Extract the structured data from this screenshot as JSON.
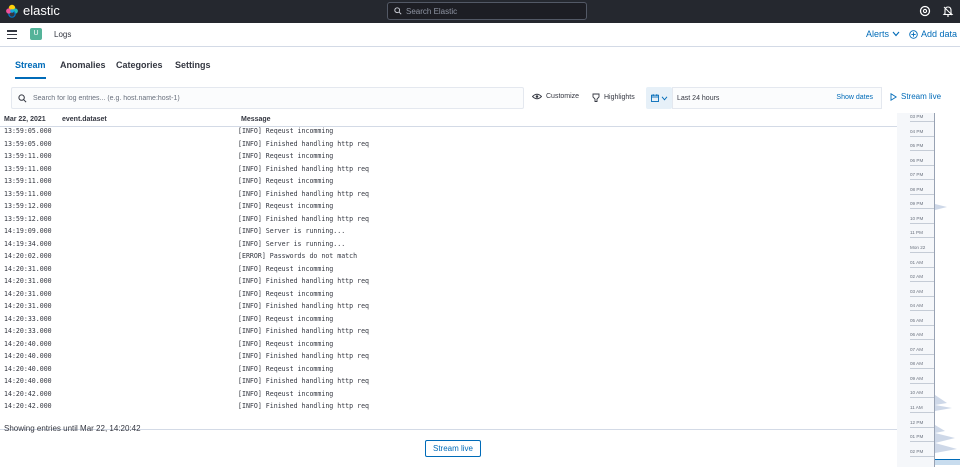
{
  "topbar": {
    "brand": "elastic",
    "search_placeholder": "Search Elastic"
  },
  "subbar": {
    "space_initial": "U",
    "breadcrumb": "Logs",
    "alerts_label": "Alerts",
    "add_data_label": "Add data"
  },
  "tabs": [
    {
      "label": "Stream",
      "active": true
    },
    {
      "label": "Anomalies",
      "active": false
    },
    {
      "label": "Categories",
      "active": false
    },
    {
      "label": "Settings",
      "active": false
    }
  ],
  "toolbar": {
    "search_placeholder": "Search for log entries... (e.g. host.name:host-1)",
    "customize_label": "Customize",
    "highlights_label": "Highlights",
    "time_range": "Last 24 hours",
    "show_dates_label": "Show dates",
    "stream_live_label": "Stream live"
  },
  "table": {
    "date_header": "Mar 22, 2021",
    "dataset_header": "event.dataset",
    "message_header": "Message",
    "rows": [
      {
        "ts": "13:59:05.000",
        "msg": "[INFO] Reqeust incomming"
      },
      {
        "ts": "13:59:05.000",
        "msg": "[INFO] Finished handling http req"
      },
      {
        "ts": "13:59:11.000",
        "msg": "[INFO] Reqeust incomming"
      },
      {
        "ts": "13:59:11.000",
        "msg": "[INFO] Finished handling http req"
      },
      {
        "ts": "13:59:11.000",
        "msg": "[INFO] Reqeust incomming"
      },
      {
        "ts": "13:59:11.000",
        "msg": "[INFO] Finished handling http req"
      },
      {
        "ts": "13:59:12.000",
        "msg": "[INFO] Reqeust incomming"
      },
      {
        "ts": "13:59:12.000",
        "msg": "[INFO] Finished handling http req"
      },
      {
        "ts": "14:19:09.000",
        "msg": "[INFO] Server is running..."
      },
      {
        "ts": "14:19:34.000",
        "msg": "[INFO] Server is running..."
      },
      {
        "ts": "14:20:02.000",
        "msg": "[ERROR] Passwords do not match"
      },
      {
        "ts": "14:20:31.000",
        "msg": "[INFO] Reqeust incomming"
      },
      {
        "ts": "14:20:31.000",
        "msg": "[INFO] Finished handling http req"
      },
      {
        "ts": "14:20:31.000",
        "msg": "[INFO] Reqeust incomming"
      },
      {
        "ts": "14:20:31.000",
        "msg": "[INFO] Finished handling http req"
      },
      {
        "ts": "14:20:33.000",
        "msg": "[INFO] Reqeust incomming"
      },
      {
        "ts": "14:20:33.000",
        "msg": "[INFO] Finished handling http req"
      },
      {
        "ts": "14:20:40.000",
        "msg": "[INFO] Reqeust incomming"
      },
      {
        "ts": "14:20:40.000",
        "msg": "[INFO] Finished handling http req"
      },
      {
        "ts": "14:20:40.000",
        "msg": "[INFO] Reqeust incomming"
      },
      {
        "ts": "14:20:40.000",
        "msg": "[INFO] Finished handling http req"
      },
      {
        "ts": "14:20:42.000",
        "msg": "[INFO] Reqeust incomming"
      },
      {
        "ts": "14:20:42.000",
        "msg": "[INFO] Finished handling http req"
      }
    ],
    "footer_text": "Showing entries until Mar 22, 14:20:42",
    "stream_live_button": "Stream live"
  },
  "minimap": {
    "ticks": [
      "03 PM",
      "04 PM",
      "05 PM",
      "06 PM",
      "07 PM",
      "08 PM",
      "09 PM",
      "10 PM",
      "11 PM",
      "Mon 22",
      "01 AM",
      "02 AM",
      "03 AM",
      "04 AM",
      "05 AM",
      "06 AM",
      "07 AM",
      "08 AM",
      "09 AM",
      "10 AM",
      "11 AM",
      "12 PM",
      "01 PM",
      "02 PM"
    ]
  },
  "colors": {
    "accent": "#006bb8",
    "header_dark": "#25282f",
    "space_avatar": "#54b399"
  }
}
